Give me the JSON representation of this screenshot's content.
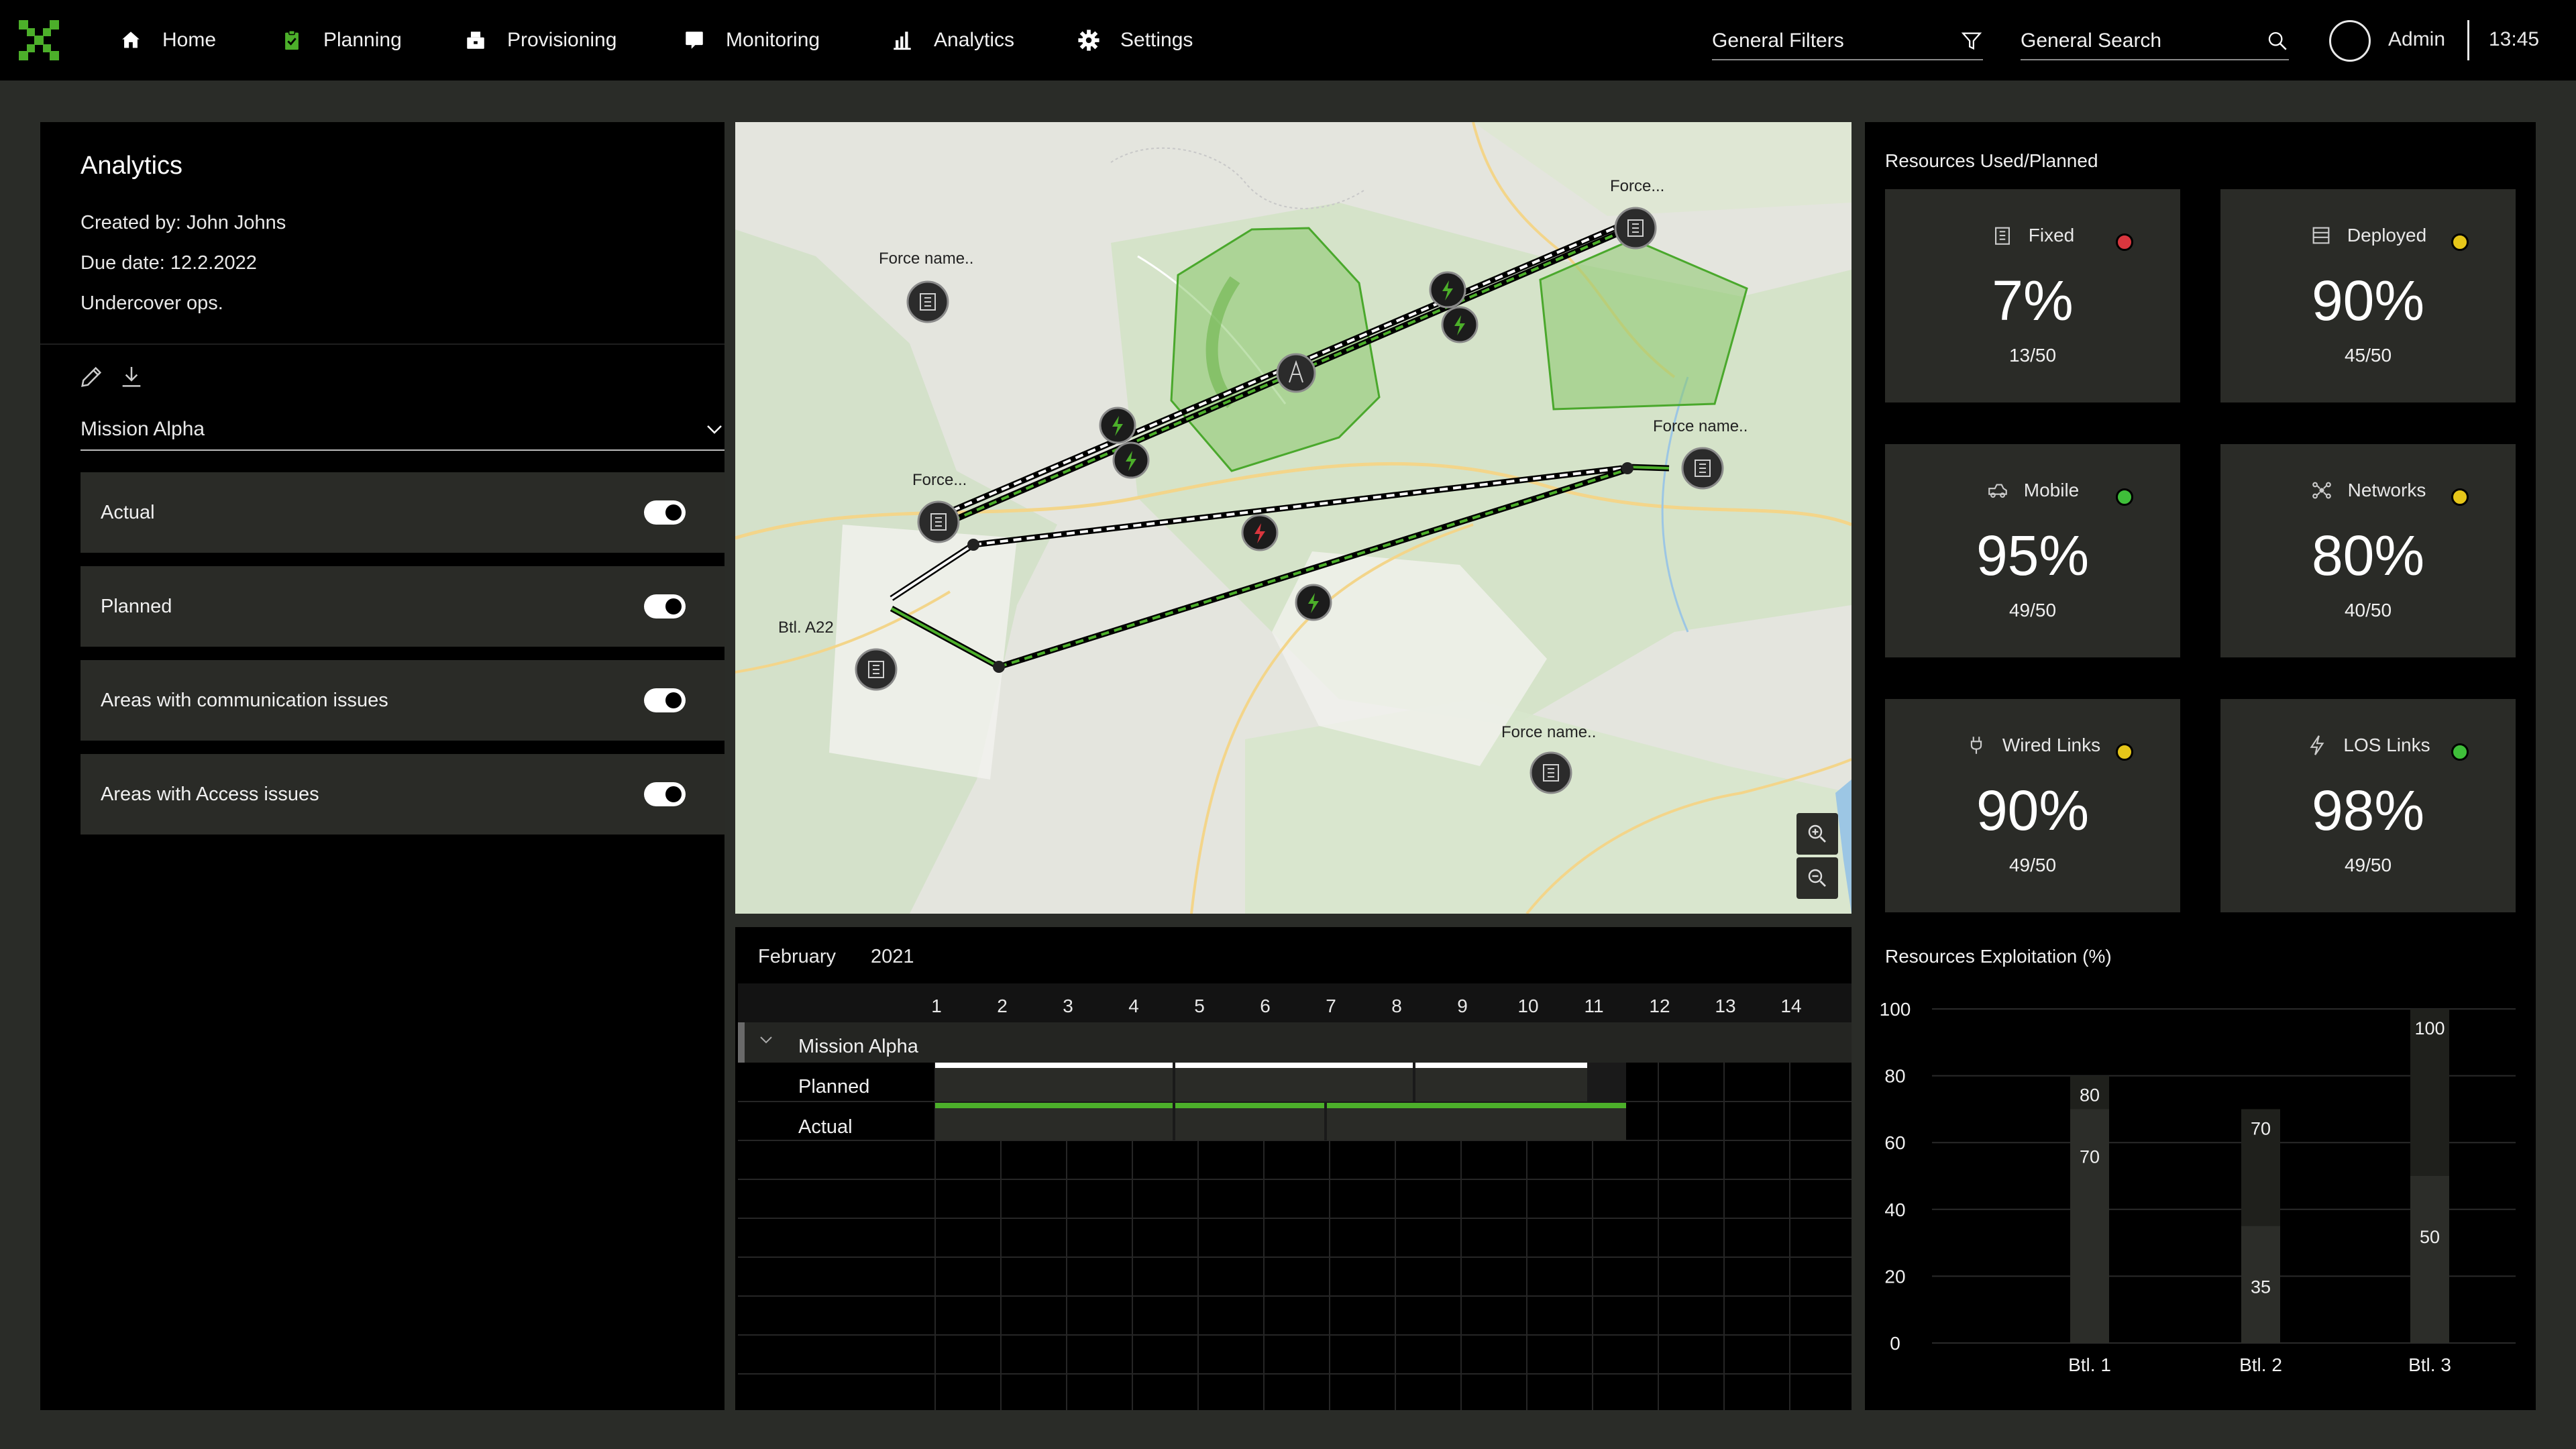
{
  "nav": {
    "items": [
      {
        "label": "Home",
        "icon": "home-icon"
      },
      {
        "label": "Planning",
        "icon": "clipboard-icon"
      },
      {
        "label": "Provisioning",
        "icon": "provisioning-icon"
      },
      {
        "label": "Monitoring",
        "icon": "monitor-icon"
      },
      {
        "label": "Analytics",
        "icon": "bar-chart-icon"
      },
      {
        "label": "Settings",
        "icon": "gear-icon"
      }
    ],
    "filters_label": "General Filters",
    "search_label": "General Search",
    "user": "Admin",
    "time": "13:45",
    "accent": "#4caf2a"
  },
  "left_panel": {
    "title": "Analytics",
    "created_by": "Created by: John Johns",
    "due_date": "Due date: 12.2.2022",
    "description": "Undercover ops.",
    "mission_select": "Mission Alpha",
    "toggles": [
      {
        "label": "Actual",
        "on": true
      },
      {
        "label": "Planned",
        "on": true
      },
      {
        "label": "Areas with communication issues",
        "on": true
      },
      {
        "label": "Areas with Access issues",
        "on": true
      }
    ]
  },
  "map": {
    "labels": {
      "force_tl": "Force name..",
      "force_top": "Force...",
      "force_mid_left": "Force...",
      "force_right": "Force name..",
      "btl": "Btl. A22",
      "force_bottom": "Force name.."
    }
  },
  "timeline": {
    "month": "February",
    "year": "2021",
    "days": [
      "1",
      "2",
      "3",
      "4",
      "5",
      "6",
      "7",
      "8",
      "9",
      "10",
      "11",
      "12",
      "13",
      "14"
    ],
    "group": "Mission Alpha",
    "rows": [
      "Planned",
      "Actual"
    ]
  },
  "resources": {
    "title": "Resources Used/Planned",
    "cards": [
      {
        "label": "Fixed",
        "pct": "7%",
        "ratio": "13/50",
        "status": "#d9363e",
        "icon": "building-icon"
      },
      {
        "label": "Deployed",
        "pct": "90%",
        "ratio": "45/50",
        "status": "#e6c619",
        "icon": "server-icon"
      },
      {
        "label": "Mobile",
        "pct": "95%",
        "ratio": "49/50",
        "status": "#3fbf3a",
        "icon": "vehicle-icon"
      },
      {
        "label": "Networks",
        "pct": "80%",
        "ratio": "40/50",
        "status": "#e6c619",
        "icon": "network-icon"
      },
      {
        "label": "Wired Links",
        "pct": "90%",
        "ratio": "49/50",
        "status": "#e6c619",
        "icon": "plug-icon"
      },
      {
        "label": "LOS Links",
        "pct": "98%",
        "ratio": "49/50",
        "status": "#3fbf3a",
        "icon": "lightning-icon"
      }
    ]
  },
  "chart_data": {
    "type": "bar",
    "title": "Resources Exploitation (%)",
    "categories": [
      "Btl. 1",
      "Btl. 2",
      "Btl. 3"
    ],
    "series": [
      {
        "values": [
          80,
          70,
          100
        ]
      },
      {
        "values": [
          70,
          35,
          50
        ]
      }
    ],
    "ylim": [
      0,
      100
    ],
    "yticks": [
      0,
      20,
      40,
      60,
      80,
      100
    ],
    "grid": true
  }
}
